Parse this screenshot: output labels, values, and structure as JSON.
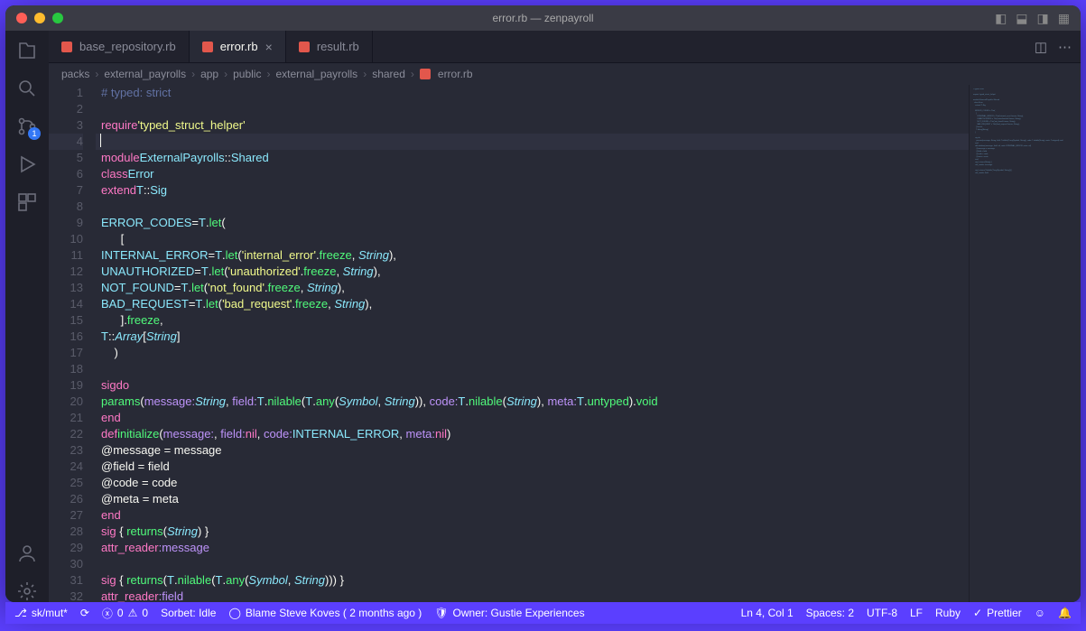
{
  "window_title": "error.rb — zenpayroll",
  "tabs": [
    {
      "label": "base_repository.rb",
      "active": false
    },
    {
      "label": "error.rb",
      "active": true
    },
    {
      "label": "result.rb",
      "active": false
    }
  ],
  "breadcrumb": [
    "packs",
    "external_payrolls",
    "app",
    "public",
    "external_payrolls",
    "shared",
    "error.rb"
  ],
  "source_control_badge": "1",
  "code_lines": [
    {
      "n": 1,
      "html": "<span class='c-comment'># typed: strict</span>"
    },
    {
      "n": 2,
      "html": ""
    },
    {
      "n": 3,
      "html": "<span class='c-key'>require</span> <span class='c-str'>'typed_struct_helper'</span>"
    },
    {
      "n": 4,
      "html": "",
      "hl": true,
      "cursor": true
    },
    {
      "n": 5,
      "html": "<span class='c-key'>module</span> <span class='c-class'>ExternalPayrolls</span><span class='c-pun'>::</span><span class='c-class'>Shared</span>"
    },
    {
      "n": 6,
      "html": "  <span class='c-key'>class</span> <span class='c-class'>Error</span>"
    },
    {
      "n": 7,
      "html": "    <span class='c-key'>extend</span> <span class='c-const'>T</span><span class='c-pun'>::</span><span class='c-const'>Sig</span>"
    },
    {
      "n": 8,
      "html": ""
    },
    {
      "n": 9,
      "html": "    <span class='c-const'>ERROR_CODES</span> <span class='c-pun'>=</span> <span class='c-const'>T</span>.<span class='c-meth'>let</span>("
    },
    {
      "n": 10,
      "html": "      ["
    },
    {
      "n": 11,
      "html": "        <span class='c-const'>INTERNAL_ERROR</span> <span class='c-pun'>=</span> <span class='c-const'>T</span>.<span class='c-meth'>let</span>(<span class='c-str'>'internal_error'</span>.<span class='c-meth'>freeze</span>, <span class='c-type'>String</span>),"
    },
    {
      "n": 12,
      "html": "        <span class='c-const'>UNAUTHORIZED</span> <span class='c-pun'>=</span> <span class='c-const'>T</span>.<span class='c-meth'>let</span>(<span class='c-str'>'unauthorized'</span>.<span class='c-meth'>freeze</span>, <span class='c-type'>String</span>),"
    },
    {
      "n": 13,
      "html": "        <span class='c-const'>NOT_FOUND</span> <span class='c-pun'>=</span> <span class='c-const'>T</span>.<span class='c-meth'>let</span>(<span class='c-str'>'not_found'</span>.<span class='c-meth'>freeze</span>, <span class='c-type'>String</span>),"
    },
    {
      "n": 14,
      "html": "        <span class='c-const'>BAD_REQUEST</span> <span class='c-pun'>=</span> <span class='c-const'>T</span>.<span class='c-meth'>let</span>(<span class='c-str'>'bad_request'</span>.<span class='c-meth'>freeze</span>, <span class='c-type'>String</span>),"
    },
    {
      "n": 15,
      "html": "      ].<span class='c-meth'>freeze</span>,"
    },
    {
      "n": 16,
      "html": "      <span class='c-const'>T</span><span class='c-pun'>::</span><span class='c-type'>Array</span>[<span class='c-type'>String</span>]"
    },
    {
      "n": 17,
      "html": "    )"
    },
    {
      "n": 18,
      "html": ""
    },
    {
      "n": 19,
      "html": "    <span class='c-key'>sig</span> <span class='c-key'>do</span>"
    },
    {
      "n": 20,
      "html": "      <span class='c-meth'>params</span>(<span class='c-sym'>message:</span> <span class='c-type'>String</span>, <span class='c-sym'>field:</span> <span class='c-const'>T</span>.<span class='c-meth'>nilable</span>(<span class='c-const'>T</span>.<span class='c-meth'>any</span>(<span class='c-type'>Symbol</span>, <span class='c-type'>String</span>)), <span class='c-sym'>code:</span> <span class='c-const'>T</span>.<span class='c-meth'>nilable</span>(<span class='c-type'>String</span>), <span class='c-sym'>meta:</span> <span class='c-const'>T</span>.<span class='c-meth'>untyped</span>).<span class='c-meth'>void</span>"
    },
    {
      "n": 21,
      "html": "    <span class='c-key'>end</span>"
    },
    {
      "n": 22,
      "html": "    <span class='c-key'>def</span> <span class='c-meth'>initialize</span>(<span class='c-sym'>message:</span>, <span class='c-sym'>field:</span> <span class='c-key'>nil</span>, <span class='c-sym'>code:</span> <span class='c-const'>INTERNAL_ERROR</span>, <span class='c-sym'>meta:</span> <span class='c-key'>nil</span>)"
    },
    {
      "n": 23,
      "html": "      <span class='c-var'>@message</span> = message"
    },
    {
      "n": 24,
      "html": "      <span class='c-var'>@field</span> = field"
    },
    {
      "n": 25,
      "html": "      <span class='c-var'>@code</span> = code"
    },
    {
      "n": 26,
      "html": "      <span class='c-var'>@meta</span> = meta"
    },
    {
      "n": 27,
      "html": "    <span class='c-key'>end</span>"
    },
    {
      "n": 28,
      "html": "    <span class='c-key'>sig</span> { <span class='c-meth'>returns</span>(<span class='c-type'>String</span>) }"
    },
    {
      "n": 29,
      "html": "    <span class='c-key'>attr_reader</span> <span class='c-sym'>:message</span>"
    },
    {
      "n": 30,
      "html": ""
    },
    {
      "n": 31,
      "html": "    <span class='c-key'>sig</span> { <span class='c-meth'>returns</span>(<span class='c-const'>T</span>.<span class='c-meth'>nilable</span>(<span class='c-const'>T</span>.<span class='c-meth'>any</span>(<span class='c-type'>Symbol</span>, <span class='c-type'>String</span>))) }"
    },
    {
      "n": 32,
      "html": "    <span class='c-key'>attr_reader</span> <span class='c-sym'>:field</span>"
    }
  ],
  "status": {
    "branch": "sk/mut*",
    "sync": "⟳",
    "errors": "0",
    "warnings": "0",
    "sorbet": "Sorbet: Idle",
    "blame": "Blame Steve Koves ( 2 months ago )",
    "owner": "Owner: Gustie Experiences",
    "cursor": "Ln 4, Col 1",
    "spaces": "Spaces: 2",
    "encoding": "UTF-8",
    "eol": "LF",
    "lang": "Ruby",
    "prettier": "Prettier",
    "bell": "🔔"
  }
}
